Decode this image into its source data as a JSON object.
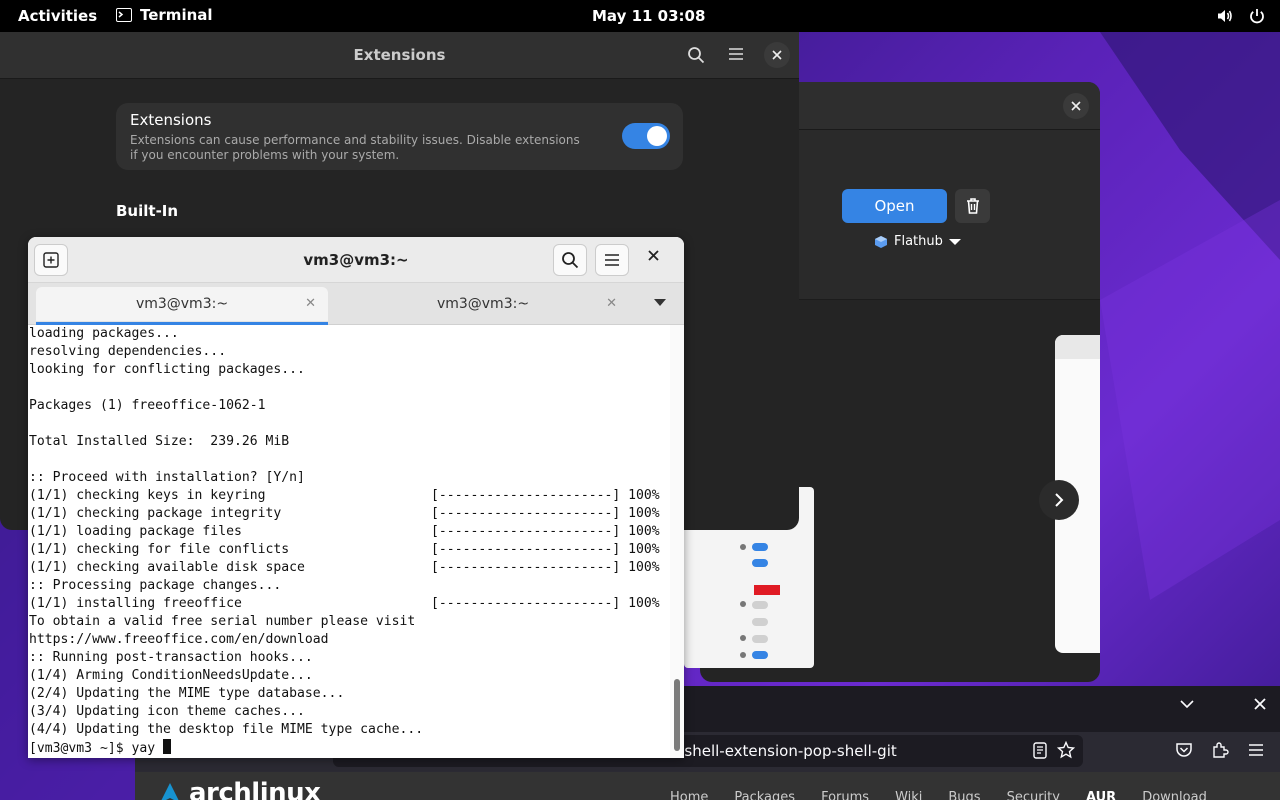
{
  "topbar": {
    "activities": "Activities",
    "app_name": "Terminal",
    "clock": "May 11  03:08"
  },
  "extensions_window": {
    "title": "Extensions",
    "card_title": "Extensions",
    "card_description": "Extensions can cause performance and stability issues. Disable extensions if you encounter problems with your system.",
    "toggle_on": true,
    "section_heading": "Built-In"
  },
  "software_window": {
    "open_label": "Open",
    "source_label": "Flathub"
  },
  "terminal": {
    "title": "vm3@vm3:~",
    "tabs": [
      {
        "label": "vm3@vm3:~",
        "active": true
      },
      {
        "label": "vm3@vm3:~",
        "active": false
      }
    ],
    "lines": [
      "loading packages...",
      "resolving dependencies...",
      "looking for conflicting packages...",
      "",
      "Packages (1) freeoffice-1062-1",
      "",
      "Total Installed Size:  239.26 MiB",
      "",
      ":: Proceed with installation? [Y/n]",
      "(1/1) checking keys in keyring                     [----------------------] 100%",
      "(1/1) checking package integrity                   [----------------------] 100%",
      "(1/1) loading package files                        [----------------------] 100%",
      "(1/1) checking for file conflicts                  [----------------------] 100%",
      "(1/1) checking available disk space                [----------------------] 100%",
      ":: Processing package changes...",
      "(1/1) installing freeoffice                        [----------------------] 100%",
      "To obtain a valid free serial number please visit",
      "https://www.freeoffice.com/en/download",
      ":: Running post-transaction hooks...",
      "(1/4) Arming ConditionNeedsUpdate...",
      "(2/4) Updating the MIME type database...",
      "(3/4) Updating icon theme caches...",
      "(4/4) Updating the desktop file MIME type cache..."
    ],
    "prompt": "[vm3@vm3 ~]$ yay "
  },
  "browser": {
    "url_fragment": "-shell-extension-pop-shell-git",
    "site_brand": "archlinux",
    "nav_items": [
      "Home",
      "Packages",
      "Forums",
      "Wiki",
      "Bugs",
      "Security",
      "AUR",
      "Download"
    ],
    "nav_active": "AUR"
  },
  "colors": {
    "accent": "#3584e4",
    "danger": "#e01b24",
    "dark_bg": "#242424"
  }
}
